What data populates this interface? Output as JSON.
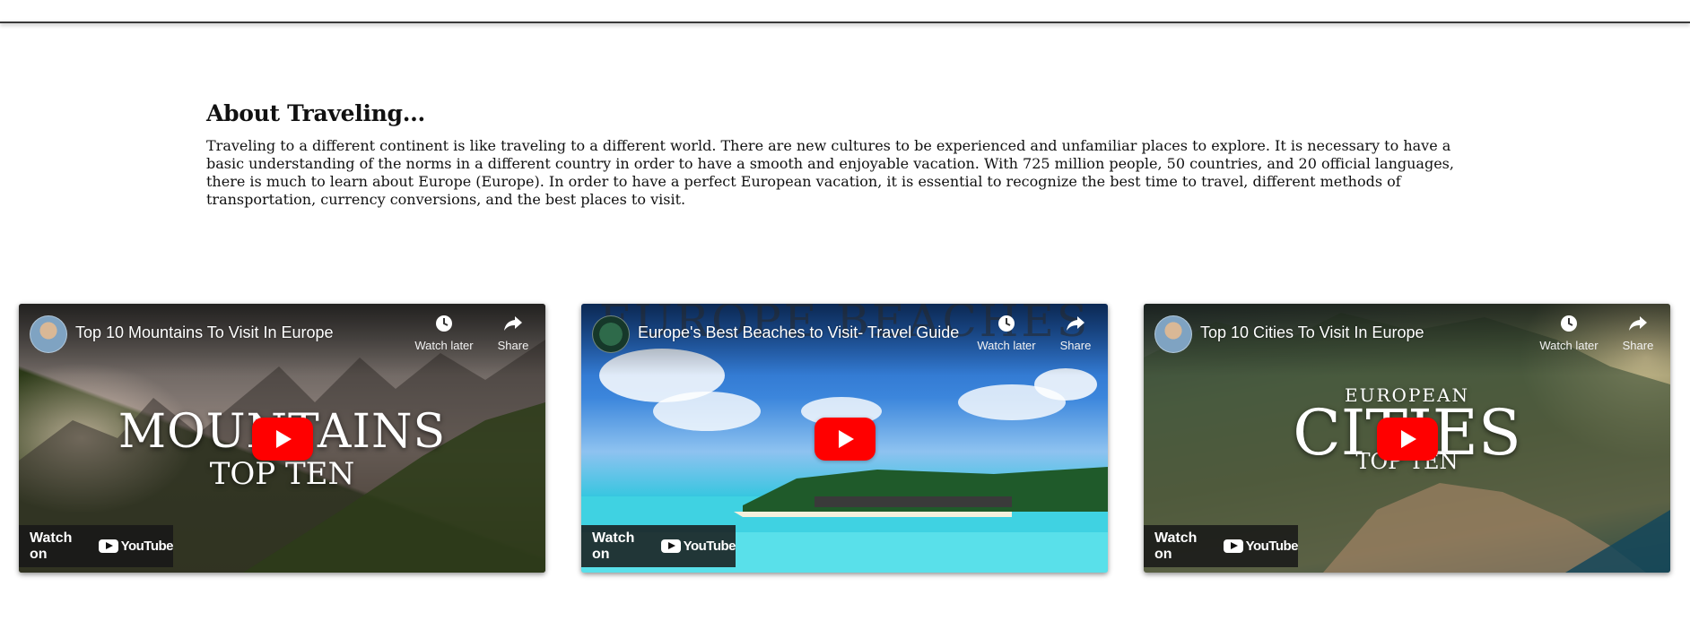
{
  "about": {
    "heading": "About Traveling...",
    "body": "Traveling to a different continent is like traveling to a different world. There are new cultures to be experienced and unfamiliar places to explore. It is necessary to have a basic understanding of the norms in a different country in order to have a smooth and enjoyable vacation. With 725 million people, 50 countries, and 20 official languages, there is much to learn about Europe (Europe). In order to have a perfect European vacation, it is essential to recognize the best time to travel, different methods of transportation, currency conversions, and the best places to visit."
  },
  "player_labels": {
    "watch_later": "Watch later",
    "share": "Share",
    "watch_on": "Watch on",
    "youtube": "YouTube"
  },
  "videos": [
    {
      "title": "Top 10 Mountains To Visit In Europe",
      "overlay_big": "MOUNTAINS",
      "overlay_small": "TOP TEN"
    },
    {
      "title": "Europe's Best Beaches to Visit- Travel Guide",
      "overlay_top": "EUROPE BEACHES"
    },
    {
      "title": "Top 10 Cities To Visit In Europe",
      "overlay_eyebrow": "EUROPEAN",
      "overlay_big": "CITIES",
      "overlay_small": "TOP TEN"
    }
  ],
  "colors": {
    "play_button": "#ff0000",
    "text": "#111111",
    "top_rule": "#3a3a3a"
  }
}
